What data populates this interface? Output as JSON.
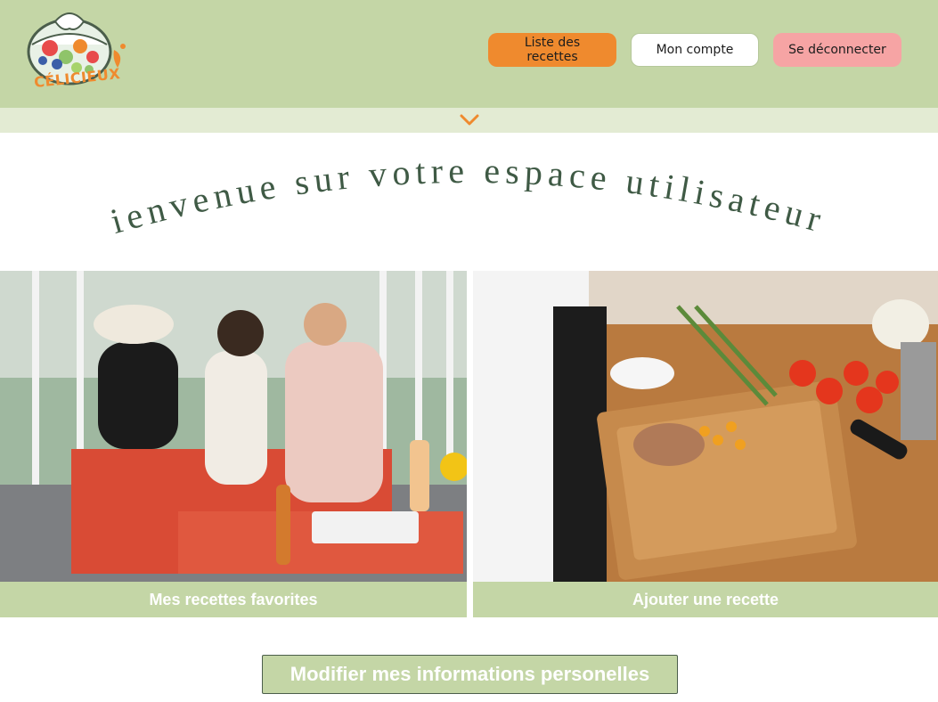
{
  "colors": {
    "header_bg": "#c4d6a6",
    "accent_orange": "#ef8a2e",
    "accent_pink": "#f6a4a4",
    "title_green": "#3f5a45",
    "subbar_bg": "#e3ebd3"
  },
  "brand": {
    "logo_text": "CÉLICIEUX",
    "logo_icon": "salad-bowl-icon"
  },
  "nav": {
    "recipes_label": "Liste des recettes",
    "account_label": "Mon compte",
    "logout_label": "Se déconnecter"
  },
  "subbar": {
    "icon": "chevron-down-icon"
  },
  "welcome": {
    "title": "Bienvenue sur votre espace utilisateur !"
  },
  "cards": [
    {
      "label": "Mes recettes favorites",
      "image": "family-eating-photo"
    },
    {
      "label": "Ajouter une recette",
      "image": "chef-cutting-vegetables-photo"
    }
  ],
  "edit_button": {
    "label": "Modifier mes informations personelles"
  }
}
